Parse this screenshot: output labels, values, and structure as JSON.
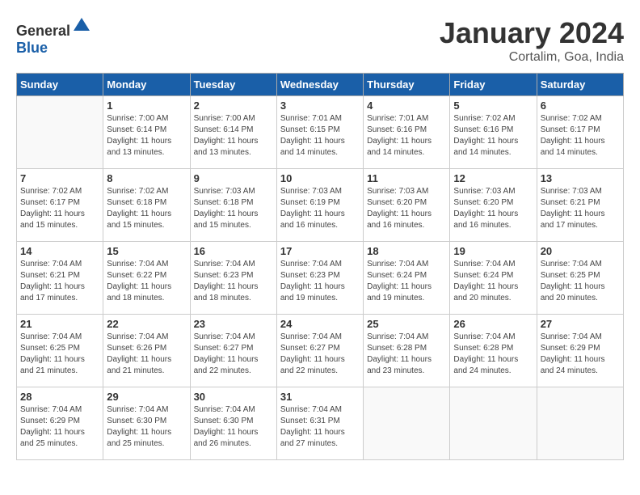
{
  "header": {
    "logo_general": "General",
    "logo_blue": "Blue",
    "month": "January 2024",
    "location": "Cortalim, Goa, India"
  },
  "weekdays": [
    "Sunday",
    "Monday",
    "Tuesday",
    "Wednesday",
    "Thursday",
    "Friday",
    "Saturday"
  ],
  "weeks": [
    [
      {
        "day": "",
        "empty": true
      },
      {
        "day": "1",
        "sunrise": "7:00 AM",
        "sunset": "6:14 PM",
        "daylight": "11 hours and 13 minutes."
      },
      {
        "day": "2",
        "sunrise": "7:00 AM",
        "sunset": "6:14 PM",
        "daylight": "11 hours and 13 minutes."
      },
      {
        "day": "3",
        "sunrise": "7:01 AM",
        "sunset": "6:15 PM",
        "daylight": "11 hours and 14 minutes."
      },
      {
        "day": "4",
        "sunrise": "7:01 AM",
        "sunset": "6:16 PM",
        "daylight": "11 hours and 14 minutes."
      },
      {
        "day": "5",
        "sunrise": "7:02 AM",
        "sunset": "6:16 PM",
        "daylight": "11 hours and 14 minutes."
      },
      {
        "day": "6",
        "sunrise": "7:02 AM",
        "sunset": "6:17 PM",
        "daylight": "11 hours and 14 minutes."
      }
    ],
    [
      {
        "day": "7",
        "sunrise": "7:02 AM",
        "sunset": "6:17 PM",
        "daylight": "11 hours and 15 minutes."
      },
      {
        "day": "8",
        "sunrise": "7:02 AM",
        "sunset": "6:18 PM",
        "daylight": "11 hours and 15 minutes."
      },
      {
        "day": "9",
        "sunrise": "7:03 AM",
        "sunset": "6:18 PM",
        "daylight": "11 hours and 15 minutes."
      },
      {
        "day": "10",
        "sunrise": "7:03 AM",
        "sunset": "6:19 PM",
        "daylight": "11 hours and 16 minutes."
      },
      {
        "day": "11",
        "sunrise": "7:03 AM",
        "sunset": "6:20 PM",
        "daylight": "11 hours and 16 minutes."
      },
      {
        "day": "12",
        "sunrise": "7:03 AM",
        "sunset": "6:20 PM",
        "daylight": "11 hours and 16 minutes."
      },
      {
        "day": "13",
        "sunrise": "7:03 AM",
        "sunset": "6:21 PM",
        "daylight": "11 hours and 17 minutes."
      }
    ],
    [
      {
        "day": "14",
        "sunrise": "7:04 AM",
        "sunset": "6:21 PM",
        "daylight": "11 hours and 17 minutes."
      },
      {
        "day": "15",
        "sunrise": "7:04 AM",
        "sunset": "6:22 PM",
        "daylight": "11 hours and 18 minutes."
      },
      {
        "day": "16",
        "sunrise": "7:04 AM",
        "sunset": "6:23 PM",
        "daylight": "11 hours and 18 minutes."
      },
      {
        "day": "17",
        "sunrise": "7:04 AM",
        "sunset": "6:23 PM",
        "daylight": "11 hours and 19 minutes."
      },
      {
        "day": "18",
        "sunrise": "7:04 AM",
        "sunset": "6:24 PM",
        "daylight": "11 hours and 19 minutes."
      },
      {
        "day": "19",
        "sunrise": "7:04 AM",
        "sunset": "6:24 PM",
        "daylight": "11 hours and 20 minutes."
      },
      {
        "day": "20",
        "sunrise": "7:04 AM",
        "sunset": "6:25 PM",
        "daylight": "11 hours and 20 minutes."
      }
    ],
    [
      {
        "day": "21",
        "sunrise": "7:04 AM",
        "sunset": "6:25 PM",
        "daylight": "11 hours and 21 minutes."
      },
      {
        "day": "22",
        "sunrise": "7:04 AM",
        "sunset": "6:26 PM",
        "daylight": "11 hours and 21 minutes."
      },
      {
        "day": "23",
        "sunrise": "7:04 AM",
        "sunset": "6:27 PM",
        "daylight": "11 hours and 22 minutes."
      },
      {
        "day": "24",
        "sunrise": "7:04 AM",
        "sunset": "6:27 PM",
        "daylight": "11 hours and 22 minutes."
      },
      {
        "day": "25",
        "sunrise": "7:04 AM",
        "sunset": "6:28 PM",
        "daylight": "11 hours and 23 minutes."
      },
      {
        "day": "26",
        "sunrise": "7:04 AM",
        "sunset": "6:28 PM",
        "daylight": "11 hours and 24 minutes."
      },
      {
        "day": "27",
        "sunrise": "7:04 AM",
        "sunset": "6:29 PM",
        "daylight": "11 hours and 24 minutes."
      }
    ],
    [
      {
        "day": "28",
        "sunrise": "7:04 AM",
        "sunset": "6:29 PM",
        "daylight": "11 hours and 25 minutes."
      },
      {
        "day": "29",
        "sunrise": "7:04 AM",
        "sunset": "6:30 PM",
        "daylight": "11 hours and 25 minutes."
      },
      {
        "day": "30",
        "sunrise": "7:04 AM",
        "sunset": "6:30 PM",
        "daylight": "11 hours and 26 minutes."
      },
      {
        "day": "31",
        "sunrise": "7:04 AM",
        "sunset": "6:31 PM",
        "daylight": "11 hours and 27 minutes."
      },
      {
        "day": "",
        "empty": true
      },
      {
        "day": "",
        "empty": true
      },
      {
        "day": "",
        "empty": true
      }
    ]
  ],
  "labels": {
    "sunrise": "Sunrise:",
    "sunset": "Sunset:",
    "daylight": "Daylight:"
  }
}
